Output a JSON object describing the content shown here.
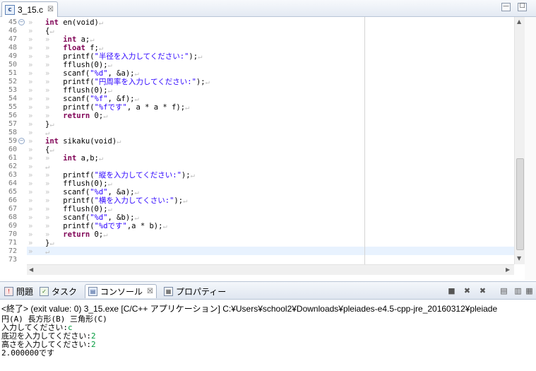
{
  "editor_tab": {
    "title": "3_15.c",
    "close": "☒"
  },
  "window_controls": {
    "minimize": "—",
    "maximize": "☐"
  },
  "code_lines": [
    {
      "n": "45",
      "fold": "−",
      "indent": "",
      "segs": [
        [
          "kw",
          "int"
        ],
        [
          "n",
          " en(void)"
        ],
        [
          "ws",
          "↵"
        ]
      ]
    },
    {
      "n": "46",
      "fold": "",
      "indent": "",
      "segs": [
        [
          "n",
          "{"
        ],
        [
          "ws",
          "↵"
        ]
      ]
    },
    {
      "n": "47",
      "fold": "",
      "indent": "1",
      "segs": [
        [
          "kw",
          "int"
        ],
        [
          "n",
          " a;"
        ],
        [
          "ws",
          "↵"
        ]
      ]
    },
    {
      "n": "48",
      "fold": "",
      "indent": "1",
      "segs": [
        [
          "kw",
          "float"
        ],
        [
          "n",
          " f;"
        ],
        [
          "ws",
          "↵"
        ]
      ]
    },
    {
      "n": "49",
      "fold": "",
      "indent": "1",
      "segs": [
        [
          "n",
          "printf("
        ],
        [
          "str",
          "\"半径を入力してください:\""
        ],
        [
          "n",
          ");"
        ],
        [
          "ws",
          "↵"
        ]
      ]
    },
    {
      "n": "50",
      "fold": "",
      "indent": "1",
      "segs": [
        [
          "n",
          "fflush(0);"
        ],
        [
          "ws",
          "↵"
        ]
      ]
    },
    {
      "n": "51",
      "fold": "",
      "indent": "1",
      "segs": [
        [
          "n",
          "scanf("
        ],
        [
          "str",
          "\"%d\""
        ],
        [
          "n",
          ", &a);"
        ],
        [
          "ws",
          "↵"
        ]
      ]
    },
    {
      "n": "52",
      "fold": "",
      "indent": "1",
      "segs": [
        [
          "n",
          "printf("
        ],
        [
          "str",
          "\"円周率を入力してください:\""
        ],
        [
          "n",
          ");"
        ],
        [
          "ws",
          "↵"
        ]
      ]
    },
    {
      "n": "53",
      "fold": "",
      "indent": "1",
      "segs": [
        [
          "n",
          "fflush(0);"
        ],
        [
          "ws",
          "↵"
        ]
      ]
    },
    {
      "n": "54",
      "fold": "",
      "indent": "1",
      "segs": [
        [
          "n",
          "scanf("
        ],
        [
          "str",
          "\"%f\""
        ],
        [
          "n",
          ", &f);"
        ],
        [
          "ws",
          "↵"
        ]
      ]
    },
    {
      "n": "55",
      "fold": "",
      "indent": "1",
      "segs": [
        [
          "n",
          "printf("
        ],
        [
          "str",
          "\"%fです\""
        ],
        [
          "n",
          ", a * a * f);"
        ],
        [
          "ws",
          "↵"
        ]
      ]
    },
    {
      "n": "56",
      "fold": "",
      "indent": "1",
      "segs": [
        [
          "kw",
          "return"
        ],
        [
          "n",
          " 0;"
        ],
        [
          "ws",
          "↵"
        ]
      ]
    },
    {
      "n": "57",
      "fold": "",
      "indent": "",
      "segs": [
        [
          "n",
          "}"
        ],
        [
          "ws",
          "↵"
        ]
      ]
    },
    {
      "n": "58",
      "fold": "",
      "indent": "",
      "segs": [
        [
          "ws",
          "↵"
        ]
      ]
    },
    {
      "n": "59",
      "fold": "−",
      "indent": "",
      "segs": [
        [
          "kw",
          "int"
        ],
        [
          "n",
          " sikaku(void)"
        ],
        [
          "ws",
          "↵"
        ]
      ]
    },
    {
      "n": "60",
      "fold": "",
      "indent": "",
      "segs": [
        [
          "n",
          "{"
        ],
        [
          "ws",
          "↵"
        ]
      ]
    },
    {
      "n": "61",
      "fold": "",
      "indent": "1",
      "segs": [
        [
          "kw",
          "int"
        ],
        [
          "n",
          " a,b;"
        ],
        [
          "ws",
          "↵"
        ]
      ]
    },
    {
      "n": "62",
      "fold": "",
      "indent": "",
      "segs": [
        [
          "ws",
          "↵"
        ]
      ]
    },
    {
      "n": "63",
      "fold": "",
      "indent": "1",
      "segs": [
        [
          "n",
          "printf("
        ],
        [
          "str",
          "\"縦を入力してください:\""
        ],
        [
          "n",
          ");"
        ],
        [
          "ws",
          "↵"
        ]
      ]
    },
    {
      "n": "64",
      "fold": "",
      "indent": "1",
      "segs": [
        [
          "n",
          "fflush(0);"
        ],
        [
          "ws",
          "↵"
        ]
      ]
    },
    {
      "n": "65",
      "fold": "",
      "indent": "1",
      "segs": [
        [
          "n",
          "scanf("
        ],
        [
          "str",
          "\"%d\""
        ],
        [
          "n",
          ", &a);"
        ],
        [
          "ws",
          "↵"
        ]
      ]
    },
    {
      "n": "66",
      "fold": "",
      "indent": "1",
      "segs": [
        [
          "n",
          "printf("
        ],
        [
          "str",
          "\"横を入力してくさい:\""
        ],
        [
          "n",
          ");"
        ],
        [
          "ws",
          "↵"
        ]
      ]
    },
    {
      "n": "67",
      "fold": "",
      "indent": "1",
      "segs": [
        [
          "n",
          "fflush(0);"
        ],
        [
          "ws",
          "↵"
        ]
      ]
    },
    {
      "n": "68",
      "fold": "",
      "indent": "1",
      "segs": [
        [
          "n",
          "scanf("
        ],
        [
          "str",
          "\"%d\""
        ],
        [
          "n",
          ", &b);"
        ],
        [
          "ws",
          "↵"
        ]
      ]
    },
    {
      "n": "69",
      "fold": "",
      "indent": "1",
      "segs": [
        [
          "n",
          "printf("
        ],
        [
          "str",
          "\"%dです\""
        ],
        [
          "n",
          ",a * b);"
        ],
        [
          "ws",
          "↵"
        ]
      ]
    },
    {
      "n": "70",
      "fold": "",
      "indent": "1",
      "segs": [
        [
          "kw",
          "return"
        ],
        [
          "n",
          " 0;"
        ],
        [
          "ws",
          "↵"
        ]
      ]
    },
    {
      "n": "71",
      "fold": "",
      "indent": "",
      "segs": [
        [
          "n",
          "}"
        ],
        [
          "ws",
          "↵"
        ]
      ]
    },
    {
      "n": "72",
      "fold": "",
      "indent": "",
      "segs": [
        [
          "ws",
          "↵"
        ]
      ]
    },
    {
      "n": "73",
      "fold": "",
      "indent": "",
      "segs": []
    }
  ],
  "view_tabs": [
    {
      "label": "問題",
      "icon": "problems-icon",
      "glyph": "!"
    },
    {
      "label": "タスク",
      "icon": "tasks-icon",
      "glyph": "✓"
    },
    {
      "label": "コンソール",
      "icon": "console-icon",
      "glyph": "▤",
      "active": true,
      "close": "☒"
    },
    {
      "label": "プロパティー",
      "icon": "properties-icon",
      "glyph": "▦"
    }
  ],
  "console_toolbar": [
    {
      "name": "terminate-icon",
      "glyph": "■"
    },
    {
      "name": "remove-launch-icon",
      "glyph": "✖"
    },
    {
      "name": "remove-all-terminated-icon",
      "glyph": "✖"
    },
    {
      "name": "clear-console-icon",
      "glyph": "▤"
    },
    {
      "name": "scroll-lock-icon",
      "glyph": "▥"
    },
    {
      "name": "pin-console-icon",
      "glyph": "▦"
    }
  ],
  "console": {
    "header": "<終了> (exit value: 0) 3_15.exe [C/C++ アプリケーション] C:¥Users¥school2¥Downloads¥pleiades-e4.5-cpp-jre_20160312¥pleiade",
    "lines": [
      [
        {
          "t": "円(A) 長方形(B) 三角形(C)"
        }
      ],
      [
        {
          "t": "入力してください:"
        },
        {
          "t": "c",
          "input": true
        }
      ],
      [
        {
          "t": "底辺を入力してください:"
        },
        {
          "t": "2",
          "input": true
        }
      ],
      [
        {
          "t": "高さを入力してください:"
        },
        {
          "t": "2",
          "input": true
        }
      ],
      [
        {
          "t": "2.000000です"
        }
      ]
    ]
  }
}
